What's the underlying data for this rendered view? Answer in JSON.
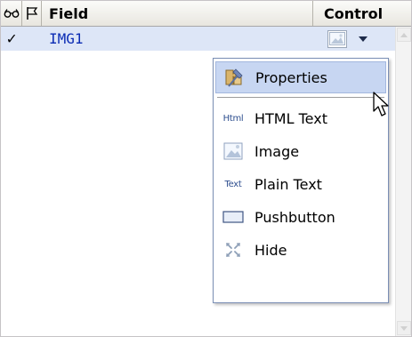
{
  "header": {
    "view_icon": "glasses-icon",
    "flag_icon": "flag-icon",
    "field_label": "Field",
    "control_label": "Control"
  },
  "rows": [
    {
      "check": "✓",
      "field": "IMG1",
      "control_icon": "image-icon",
      "selected": true
    }
  ],
  "menu": {
    "items": [
      {
        "label": "Properties",
        "icon": "properties-icon",
        "hovered": true
      },
      {
        "label": "HTML Text",
        "icon": "html-text-icon",
        "icon_text": "Html"
      },
      {
        "label": "Image",
        "icon": "image-icon"
      },
      {
        "label": "Plain Text",
        "icon": "plain-text-icon",
        "icon_text": "Text"
      },
      {
        "label": "Pushbutton",
        "icon": "pushbutton-icon"
      },
      {
        "label": "Hide",
        "icon": "hide-icon"
      }
    ]
  },
  "colors": {
    "selected_row": "#dde6f7",
    "field_text": "#0b2cb4",
    "menu_hover": "#c7d6f2",
    "menu_border": "#7a8eb4"
  }
}
